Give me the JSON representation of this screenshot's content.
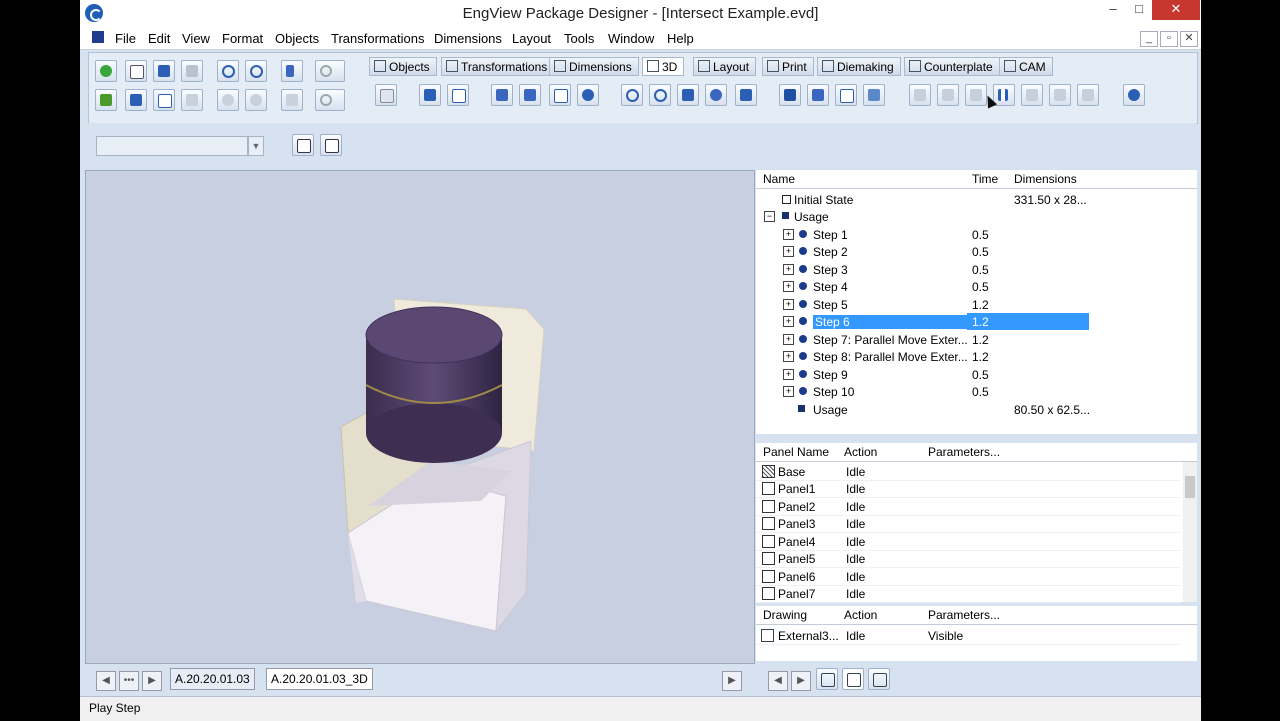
{
  "window": {
    "title": "EngView Package Designer - [Intersect Example.evd]",
    "controls": [
      "–",
      "□",
      "✕"
    ],
    "mdi_controls": [
      "_",
      "▫",
      "✕"
    ]
  },
  "menu": [
    "File",
    "Edit",
    "View",
    "Format",
    "Objects",
    "Transformations",
    "Dimensions",
    "Layout",
    "Tools",
    "Window",
    "Help"
  ],
  "module_tabs": [
    "Objects",
    "Transformations",
    "Dimensions",
    "3D",
    "Layout",
    "Print",
    "Diemaking",
    "Counterplate",
    "CAM"
  ],
  "active_tab": "3D",
  "steps_grid": {
    "headers": {
      "name": "Name",
      "time": "Time",
      "dimensions": "Dimensions"
    },
    "rows": [
      {
        "name": "Initial State",
        "time": "",
        "dim": "331.50 x 28..."
      },
      {
        "name": "Usage",
        "time": "",
        "dim": ""
      },
      {
        "name": "Step 1",
        "time": "0.5",
        "dim": ""
      },
      {
        "name": "Step 2",
        "time": "0.5",
        "dim": ""
      },
      {
        "name": "Step 3",
        "time": "0.5",
        "dim": ""
      },
      {
        "name": "Step 4",
        "time": "0.5",
        "dim": ""
      },
      {
        "name": "Step 5",
        "time": "1.2",
        "dim": ""
      },
      {
        "name": "Step 6",
        "time": "1.2",
        "dim": ""
      },
      {
        "name": "Step 7: Parallel Move Exter...",
        "time": "1.2",
        "dim": ""
      },
      {
        "name": "Step 8: Parallel Move Exter...",
        "time": "1.2",
        "dim": ""
      },
      {
        "name": "Step 9",
        "time": "0.5",
        "dim": ""
      },
      {
        "name": "Step 10",
        "time": "0.5",
        "dim": ""
      },
      {
        "name": "Usage",
        "time": "",
        "dim": "80.50 x 62.5..."
      }
    ]
  },
  "panel_grid": {
    "headers": {
      "name": "Panel Name",
      "action": "Action",
      "params": "Parameters..."
    },
    "rows": [
      {
        "name": "Base",
        "action": "Idle"
      },
      {
        "name": "Panel1",
        "action": "Idle"
      },
      {
        "name": "Panel2",
        "action": "Idle"
      },
      {
        "name": "Panel3",
        "action": "Idle"
      },
      {
        "name": "Panel4",
        "action": "Idle"
      },
      {
        "name": "Panel5",
        "action": "Idle"
      },
      {
        "name": "Panel6",
        "action": "Idle"
      },
      {
        "name": "Panel7",
        "action": "Idle"
      }
    ]
  },
  "drawing_grid": {
    "headers": {
      "drawing": "Drawing",
      "action": "Action",
      "params": "Parameters..."
    },
    "row": {
      "drawing": "External3...",
      "action": "Idle",
      "params": "Visible"
    }
  },
  "doc_tabs": [
    "A.20.20.01.03",
    "A.20.20.01.03_3D"
  ],
  "status": "Play Step",
  "colors": {
    "selection": "#3399ff",
    "lid": "#4a3a5e",
    "box": "#f2efe4"
  }
}
